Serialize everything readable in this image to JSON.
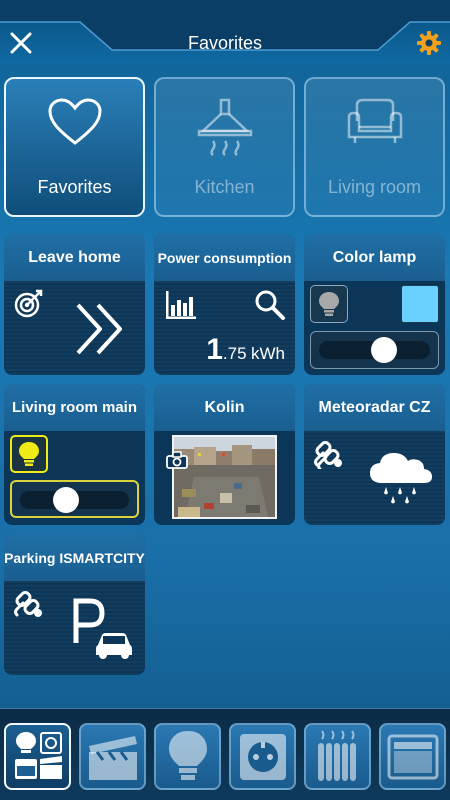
{
  "header": {
    "title": "Favorites"
  },
  "rooms": [
    {
      "label": "Favorites",
      "icon": "heart-icon",
      "active": true
    },
    {
      "label": "Kitchen",
      "icon": "range-hood-icon",
      "active": false
    },
    {
      "label": "Living room",
      "icon": "armchair-icon",
      "active": false
    }
  ],
  "tiles": {
    "leave_home": {
      "title": "Leave home",
      "icons": [
        "target-icon",
        "double-chevron-right-icon"
      ]
    },
    "power": {
      "title": "Power consumption",
      "integer": "1",
      "decimal": ".75",
      "unit": "kWh",
      "icons": [
        "bar-chart-icon",
        "magnifier-icon"
      ]
    },
    "color_lamp": {
      "title": "Color lamp",
      "swatch_color": "#6ad0fd",
      "slider_level": 0.6,
      "lamp_on": false
    },
    "living_room_main": {
      "title": "Living room main",
      "slider_level": 0.4,
      "lamp_on": true
    },
    "kolin": {
      "title": "Kolin",
      "icons": [
        "camera-icon"
      ]
    },
    "meteoradar": {
      "title": "Meteoradar CZ",
      "icons": [
        "link-icon",
        "rain-cloud-icon"
      ]
    },
    "parking": {
      "title": "Parking ISMARTCITY",
      "icons": [
        "link-icon",
        "parking-icon"
      ]
    }
  },
  "categories": [
    {
      "name": "all-devices",
      "icon": "devices-grid-icon",
      "active": true
    },
    {
      "name": "scenes",
      "icon": "clapperboard-icon",
      "active": false
    },
    {
      "name": "lights",
      "icon": "bulb-icon",
      "active": false
    },
    {
      "name": "sockets",
      "icon": "socket-icon",
      "active": false
    },
    {
      "name": "heating",
      "icon": "radiator-icon",
      "active": false
    },
    {
      "name": "blinds",
      "icon": "window-blind-icon",
      "active": false
    }
  ],
  "colors": {
    "accent": "#f0a01a",
    "lamp_on": "#f0ea17",
    "tile_header": "#1f6fa6",
    "tile_body": "#0c3657"
  }
}
